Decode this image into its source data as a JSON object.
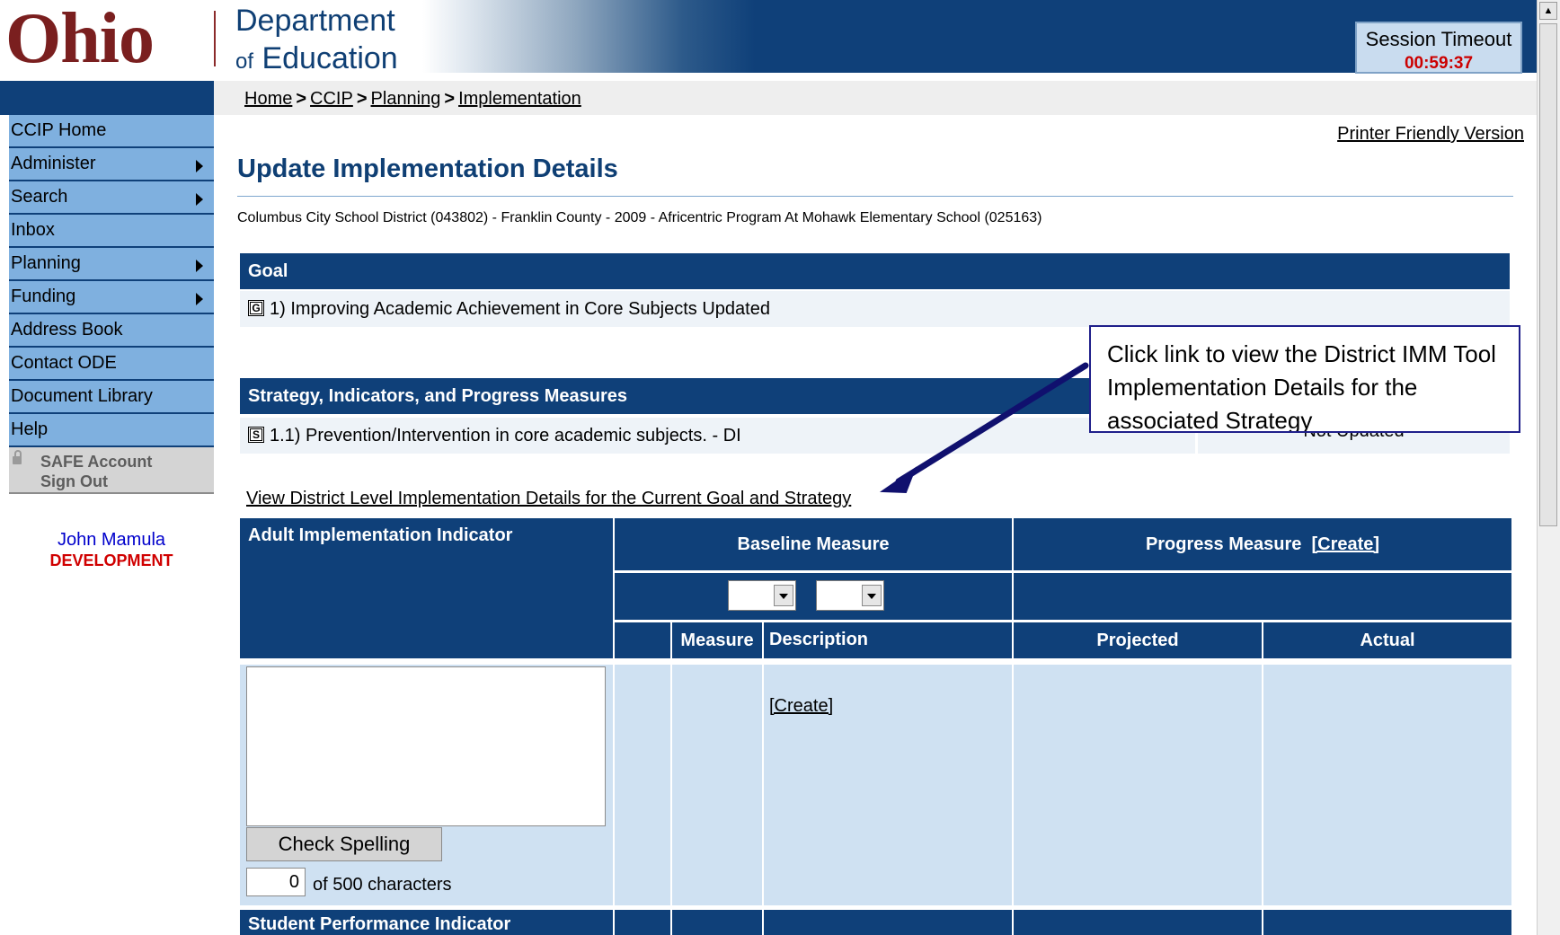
{
  "header": {
    "logo_text": "Ohio",
    "dept_line1": "Department",
    "dept_of": "of",
    "dept_line2": "Education",
    "session_label": "Session Timeout",
    "session_time": "00:59:37"
  },
  "breadcrumb": {
    "items": [
      "Home",
      "CCIP",
      "Planning",
      "Implementation"
    ],
    "separator": ">"
  },
  "sidebar": {
    "items": [
      {
        "label": "CCIP Home",
        "submenu": false
      },
      {
        "label": "Administer",
        "submenu": true
      },
      {
        "label": "Search",
        "submenu": true
      },
      {
        "label": "Inbox",
        "submenu": false
      },
      {
        "label": "Planning",
        "submenu": true
      },
      {
        "label": "Funding",
        "submenu": true
      },
      {
        "label": "Address Book",
        "submenu": false
      },
      {
        "label": "Contact ODE",
        "submenu": false
      },
      {
        "label": "Document Library",
        "submenu": false
      },
      {
        "label": "Help",
        "submenu": false
      }
    ],
    "safe_line1": "SAFE Account",
    "safe_line2": "Sign Out",
    "user_name": "John Mamula",
    "environment": "DEVELOPMENT"
  },
  "main": {
    "printer_link": "Printer Friendly Version",
    "title": "Update Implementation Details",
    "district_info": "Columbus City School District (043802) - Franklin County - 2009 - Africentric Program At Mohawk Elementary School (025163)",
    "goal": {
      "header": "Goal",
      "badge": "G",
      "text": "1) Improving Academic Achievement in Core Subjects Updated"
    },
    "strategy": {
      "header": "Strategy, Indicators, and Progress Measures",
      "badge": "S",
      "text": "1.1) Prevention/Intervention in core academic subjects. - DI",
      "status": "Not Updated"
    },
    "view_district_link": "View District Level Implementation Details for the Current Goal and Strategy",
    "callout": "Click link to view the District IMM Tool Implementation Details for the associated Strategy",
    "table": {
      "adult_indicator": "Adult Implementation Indicator",
      "baseline_measure": "Baseline Measure",
      "progress_measure": "Progress Measure",
      "progress_create": "[Create]",
      "col_measure": "Measure",
      "col_description": "Description",
      "col_projected": "Projected",
      "col_actual": "Actual",
      "create_link": "[Create]",
      "check_spelling": "Check Spelling",
      "char_count": "0",
      "char_label": "of 500 characters",
      "student_indicator": "Student Performance Indicator"
    }
  },
  "colors": {
    "header_blue": "#0f4079",
    "nav_blue": "#7fb0df",
    "light_cell": "#cfe1f2",
    "timer_red": "#cc0000"
  }
}
